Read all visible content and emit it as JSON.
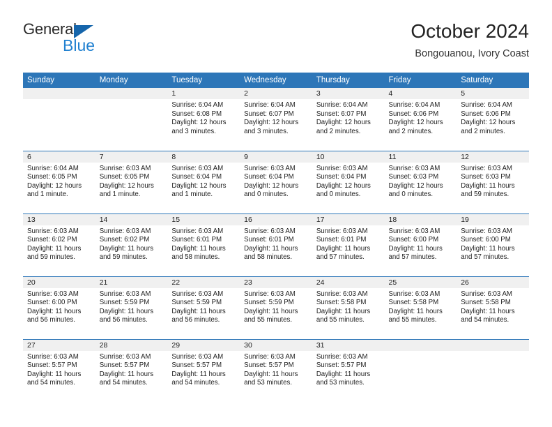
{
  "brand": {
    "name_part1": "General",
    "name_part2": "Blue",
    "triangle_color": "#1565ab",
    "blue_color": "#2080d0"
  },
  "header": {
    "month_title": "October 2024",
    "location": "Bongouanou, Ivory Coast",
    "accent_color": "#2d76b8",
    "band_color": "#f0f0f0"
  },
  "calendar": {
    "weekday_headers": [
      "Sunday",
      "Monday",
      "Tuesday",
      "Wednesday",
      "Thursday",
      "Friday",
      "Saturday"
    ],
    "weeks": [
      [
        {
          "day": "",
          "empty": true,
          "sunrise": "",
          "sunset": "",
          "daylight_line1": "",
          "daylight_line2": ""
        },
        {
          "day": "",
          "empty": true,
          "sunrise": "",
          "sunset": "",
          "daylight_line1": "",
          "daylight_line2": ""
        },
        {
          "day": "1",
          "empty": false,
          "sunrise": "Sunrise: 6:04 AM",
          "sunset": "Sunset: 6:08 PM",
          "daylight_line1": "Daylight: 12 hours",
          "daylight_line2": "and 3 minutes."
        },
        {
          "day": "2",
          "empty": false,
          "sunrise": "Sunrise: 6:04 AM",
          "sunset": "Sunset: 6:07 PM",
          "daylight_line1": "Daylight: 12 hours",
          "daylight_line2": "and 3 minutes."
        },
        {
          "day": "3",
          "empty": false,
          "sunrise": "Sunrise: 6:04 AM",
          "sunset": "Sunset: 6:07 PM",
          "daylight_line1": "Daylight: 12 hours",
          "daylight_line2": "and 2 minutes."
        },
        {
          "day": "4",
          "empty": false,
          "sunrise": "Sunrise: 6:04 AM",
          "sunset": "Sunset: 6:06 PM",
          "daylight_line1": "Daylight: 12 hours",
          "daylight_line2": "and 2 minutes."
        },
        {
          "day": "5",
          "empty": false,
          "sunrise": "Sunrise: 6:04 AM",
          "sunset": "Sunset: 6:06 PM",
          "daylight_line1": "Daylight: 12 hours",
          "daylight_line2": "and 2 minutes."
        }
      ],
      [
        {
          "day": "6",
          "empty": false,
          "sunrise": "Sunrise: 6:04 AM",
          "sunset": "Sunset: 6:05 PM",
          "daylight_line1": "Daylight: 12 hours",
          "daylight_line2": "and 1 minute."
        },
        {
          "day": "7",
          "empty": false,
          "sunrise": "Sunrise: 6:03 AM",
          "sunset": "Sunset: 6:05 PM",
          "daylight_line1": "Daylight: 12 hours",
          "daylight_line2": "and 1 minute."
        },
        {
          "day": "8",
          "empty": false,
          "sunrise": "Sunrise: 6:03 AM",
          "sunset": "Sunset: 6:04 PM",
          "daylight_line1": "Daylight: 12 hours",
          "daylight_line2": "and 1 minute."
        },
        {
          "day": "9",
          "empty": false,
          "sunrise": "Sunrise: 6:03 AM",
          "sunset": "Sunset: 6:04 PM",
          "daylight_line1": "Daylight: 12 hours",
          "daylight_line2": "and 0 minutes."
        },
        {
          "day": "10",
          "empty": false,
          "sunrise": "Sunrise: 6:03 AM",
          "sunset": "Sunset: 6:04 PM",
          "daylight_line1": "Daylight: 12 hours",
          "daylight_line2": "and 0 minutes."
        },
        {
          "day": "11",
          "empty": false,
          "sunrise": "Sunrise: 6:03 AM",
          "sunset": "Sunset: 6:03 PM",
          "daylight_line1": "Daylight: 12 hours",
          "daylight_line2": "and 0 minutes."
        },
        {
          "day": "12",
          "empty": false,
          "sunrise": "Sunrise: 6:03 AM",
          "sunset": "Sunset: 6:03 PM",
          "daylight_line1": "Daylight: 11 hours",
          "daylight_line2": "and 59 minutes."
        }
      ],
      [
        {
          "day": "13",
          "empty": false,
          "sunrise": "Sunrise: 6:03 AM",
          "sunset": "Sunset: 6:02 PM",
          "daylight_line1": "Daylight: 11 hours",
          "daylight_line2": "and 59 minutes."
        },
        {
          "day": "14",
          "empty": false,
          "sunrise": "Sunrise: 6:03 AM",
          "sunset": "Sunset: 6:02 PM",
          "daylight_line1": "Daylight: 11 hours",
          "daylight_line2": "and 59 minutes."
        },
        {
          "day": "15",
          "empty": false,
          "sunrise": "Sunrise: 6:03 AM",
          "sunset": "Sunset: 6:01 PM",
          "daylight_line1": "Daylight: 11 hours",
          "daylight_line2": "and 58 minutes."
        },
        {
          "day": "16",
          "empty": false,
          "sunrise": "Sunrise: 6:03 AM",
          "sunset": "Sunset: 6:01 PM",
          "daylight_line1": "Daylight: 11 hours",
          "daylight_line2": "and 58 minutes."
        },
        {
          "day": "17",
          "empty": false,
          "sunrise": "Sunrise: 6:03 AM",
          "sunset": "Sunset: 6:01 PM",
          "daylight_line1": "Daylight: 11 hours",
          "daylight_line2": "and 57 minutes."
        },
        {
          "day": "18",
          "empty": false,
          "sunrise": "Sunrise: 6:03 AM",
          "sunset": "Sunset: 6:00 PM",
          "daylight_line1": "Daylight: 11 hours",
          "daylight_line2": "and 57 minutes."
        },
        {
          "day": "19",
          "empty": false,
          "sunrise": "Sunrise: 6:03 AM",
          "sunset": "Sunset: 6:00 PM",
          "daylight_line1": "Daylight: 11 hours",
          "daylight_line2": "and 57 minutes."
        }
      ],
      [
        {
          "day": "20",
          "empty": false,
          "sunrise": "Sunrise: 6:03 AM",
          "sunset": "Sunset: 6:00 PM",
          "daylight_line1": "Daylight: 11 hours",
          "daylight_line2": "and 56 minutes."
        },
        {
          "day": "21",
          "empty": false,
          "sunrise": "Sunrise: 6:03 AM",
          "sunset": "Sunset: 5:59 PM",
          "daylight_line1": "Daylight: 11 hours",
          "daylight_line2": "and 56 minutes."
        },
        {
          "day": "22",
          "empty": false,
          "sunrise": "Sunrise: 6:03 AM",
          "sunset": "Sunset: 5:59 PM",
          "daylight_line1": "Daylight: 11 hours",
          "daylight_line2": "and 56 minutes."
        },
        {
          "day": "23",
          "empty": false,
          "sunrise": "Sunrise: 6:03 AM",
          "sunset": "Sunset: 5:59 PM",
          "daylight_line1": "Daylight: 11 hours",
          "daylight_line2": "and 55 minutes."
        },
        {
          "day": "24",
          "empty": false,
          "sunrise": "Sunrise: 6:03 AM",
          "sunset": "Sunset: 5:58 PM",
          "daylight_line1": "Daylight: 11 hours",
          "daylight_line2": "and 55 minutes."
        },
        {
          "day": "25",
          "empty": false,
          "sunrise": "Sunrise: 6:03 AM",
          "sunset": "Sunset: 5:58 PM",
          "daylight_line1": "Daylight: 11 hours",
          "daylight_line2": "and 55 minutes."
        },
        {
          "day": "26",
          "empty": false,
          "sunrise": "Sunrise: 6:03 AM",
          "sunset": "Sunset: 5:58 PM",
          "daylight_line1": "Daylight: 11 hours",
          "daylight_line2": "and 54 minutes."
        }
      ],
      [
        {
          "day": "27",
          "empty": false,
          "sunrise": "Sunrise: 6:03 AM",
          "sunset": "Sunset: 5:57 PM",
          "daylight_line1": "Daylight: 11 hours",
          "daylight_line2": "and 54 minutes."
        },
        {
          "day": "28",
          "empty": false,
          "sunrise": "Sunrise: 6:03 AM",
          "sunset": "Sunset: 5:57 PM",
          "daylight_line1": "Daylight: 11 hours",
          "daylight_line2": "and 54 minutes."
        },
        {
          "day": "29",
          "empty": false,
          "sunrise": "Sunrise: 6:03 AM",
          "sunset": "Sunset: 5:57 PM",
          "daylight_line1": "Daylight: 11 hours",
          "daylight_line2": "and 54 minutes."
        },
        {
          "day": "30",
          "empty": false,
          "sunrise": "Sunrise: 6:03 AM",
          "sunset": "Sunset: 5:57 PM",
          "daylight_line1": "Daylight: 11 hours",
          "daylight_line2": "and 53 minutes."
        },
        {
          "day": "31",
          "empty": false,
          "sunrise": "Sunrise: 6:03 AM",
          "sunset": "Sunset: 5:57 PM",
          "daylight_line1": "Daylight: 11 hours",
          "daylight_line2": "and 53 minutes."
        },
        {
          "day": "",
          "empty": true,
          "sunrise": "",
          "sunset": "",
          "daylight_line1": "",
          "daylight_line2": ""
        },
        {
          "day": "",
          "empty": true,
          "sunrise": "",
          "sunset": "",
          "daylight_line1": "",
          "daylight_line2": ""
        }
      ]
    ]
  }
}
